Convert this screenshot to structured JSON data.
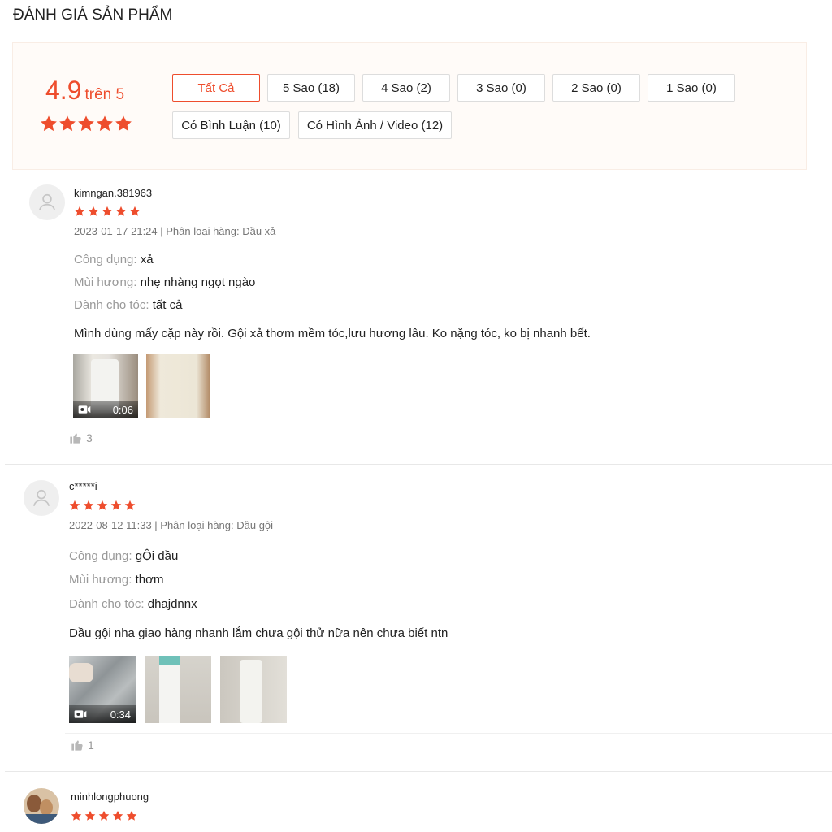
{
  "header": {
    "title": "ĐÁNH GIÁ SẢN PHẨM"
  },
  "summary": {
    "rating": "4.9",
    "rating_suffix": "trên 5",
    "stars_value": 5,
    "star_color": "#ee4d2d",
    "filters": [
      {
        "label": "Tất Cả",
        "active": true
      },
      {
        "label": "5 Sao (18)"
      },
      {
        "label": "4 Sao (2)"
      },
      {
        "label": "3 Sao (0)"
      },
      {
        "label": "2 Sao (0)"
      },
      {
        "label": "1 Sao (0)"
      },
      {
        "label": "Có Bình Luận (10)"
      },
      {
        "label": "Có Hình Ảnh / Video (12)"
      }
    ]
  },
  "reviews": [
    {
      "username": "kimngan.381963",
      "stars": 5,
      "meta": "2023-01-17 21:24 | Phân loại hàng: Dầu xả",
      "attributes": [
        {
          "label": "Công dụng:",
          "value": "xả"
        },
        {
          "label": "Mùi hương:",
          "value": "nhẹ nhàng ngọt ngào"
        },
        {
          "label": "Dành cho tóc:",
          "value": "tất cả"
        }
      ],
      "comment": "Mình dùng mấy cặp này rồi. Gội xả thơm mềm tóc,lưu hương lâu. Ko nặng tóc, ko bị nhanh bết.",
      "video_duration": "0:06",
      "likes": "3"
    },
    {
      "username": "c*****i",
      "stars": 5,
      "meta": "2022-08-12 11:33 | Phân loại hàng: Dầu gội",
      "attributes": [
        {
          "label": "Công dụng:",
          "value": "gỘi đầu"
        },
        {
          "label": "Mùi hương:",
          "value": "thơm"
        },
        {
          "label": "Dành cho tóc:",
          "value": "dhajdnnx"
        }
      ],
      "comment": "Dầu gội nha giao hàng nhanh lắm chưa gội thử nữa nên chưa biết ntn",
      "video_duration": "0:34",
      "likes": "1"
    },
    {
      "username": "minhlongphuong",
      "stars": 5
    }
  ]
}
